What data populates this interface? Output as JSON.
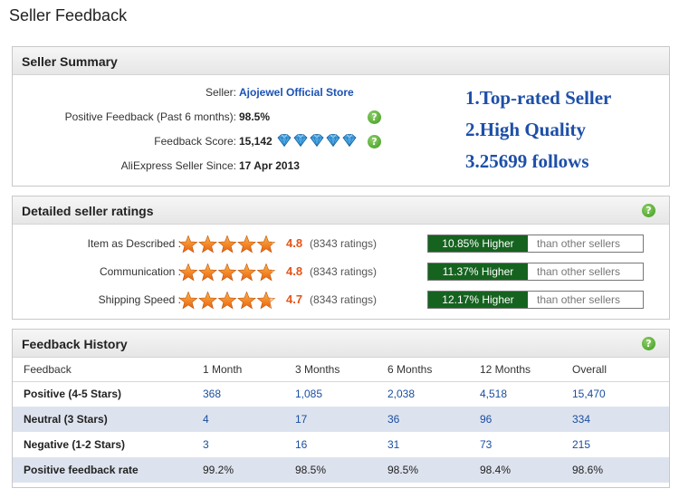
{
  "page": {
    "title": "Seller Feedback"
  },
  "summary": {
    "title": "Seller Summary",
    "seller_label": "Seller:",
    "seller_value": "Ajojewel Official Store",
    "positive_label": "Positive Feedback (Past 6 months):",
    "positive_value": "98.5%",
    "score_label": "Feedback Score:",
    "score_value": "15,142",
    "score_diamonds": 5,
    "since_label": "AliExpress Seller Since:",
    "since_value": "17 Apr 2013",
    "highlights": [
      "1.Top-rated Seller",
      "2.High Quality",
      "3.25699 follows"
    ]
  },
  "ratings": {
    "title": "Detailed seller ratings",
    "compare_text": "than other sellers",
    "items": [
      {
        "label": "Item as Described :",
        "score": "4.8",
        "count": "(8343 ratings)",
        "compare": "10.85% Higher",
        "stars": 4.8
      },
      {
        "label": "Communication :",
        "score": "4.8",
        "count": "(8343 ratings)",
        "compare": "11.37% Higher",
        "stars": 4.8
      },
      {
        "label": "Shipping Speed :",
        "score": "4.7",
        "count": "(8343 ratings)",
        "compare": "12.17% Higher",
        "stars": 4.7
      }
    ]
  },
  "history": {
    "title": "Feedback History",
    "headers": [
      "Feedback",
      "1 Month",
      "3 Months",
      "6 Months",
      "12 Months",
      "Overall"
    ],
    "rows": [
      [
        "Positive (4-5 Stars)",
        "368",
        "1,085",
        "2,038",
        "4,518",
        "15,470"
      ],
      [
        "Neutral (3 Stars)",
        "4",
        "17",
        "36",
        "96",
        "334"
      ],
      [
        "Negative (1-2 Stars)",
        "3",
        "16",
        "31",
        "73",
        "215"
      ],
      [
        "Positive feedback rate",
        "99.2%",
        "98.5%",
        "98.5%",
        "98.4%",
        "98.6%"
      ]
    ]
  },
  "colors": {
    "accent": "#1a52b4",
    "score": "#e5541a",
    "compare_bg": "#15631f",
    "star": "#f08a1c"
  },
  "icons": {
    "help": "question-mark-icon",
    "star": "star-icon",
    "diamond": "diamond-icon"
  }
}
